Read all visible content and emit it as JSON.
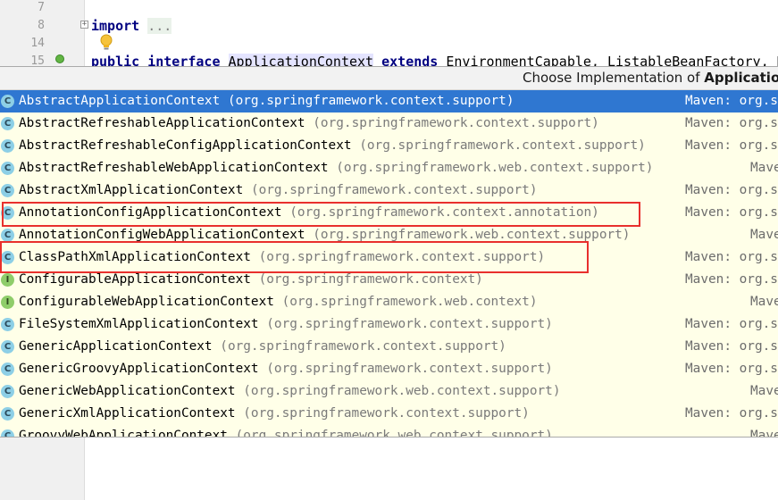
{
  "editor": {
    "gutter_lines": [
      "7",
      "8",
      "14",
      "15"
    ],
    "line8_keyword": "import",
    "line8_fold": "...",
    "line15": {
      "kw_public": "public",
      "kw_interface": "interface",
      "name": "ApplicationContext",
      "kw_extends": "extends",
      "supers": "EnvironmentCapable, ListableBeanFactory, H"
    },
    "icons": [
      "fold-marker-icon",
      "lightbulb-icon",
      "implemented-by-icon"
    ]
  },
  "popup": {
    "title_prefix": "Choose Implementation of ",
    "title_bold": "ApplicationC",
    "items": [
      {
        "icon": "class-icon",
        "icon_glyph": "C",
        "name": "AbstractApplicationContext",
        "package": "(org.springframework.context.support)",
        "maven": "Maven: org.s"
      },
      {
        "icon": "class-icon",
        "icon_glyph": "C",
        "name": "AbstractRefreshableApplicationContext",
        "package": "(org.springframework.context.support)",
        "maven": "Maven: org.s"
      },
      {
        "icon": "class-icon",
        "icon_glyph": "C",
        "name": "AbstractRefreshableConfigApplicationContext",
        "package": "(org.springframework.context.support)",
        "maven": "Maven: org.s"
      },
      {
        "icon": "class-icon",
        "icon_glyph": "C",
        "name": "AbstractRefreshableWebApplicationContext",
        "package": "(org.springframework.web.context.support)",
        "maven": "Mave"
      },
      {
        "icon": "class-icon",
        "icon_glyph": "C",
        "name": "AbstractXmlApplicationContext",
        "package": "(org.springframework.context.support)",
        "maven": "Maven: org.s"
      },
      {
        "icon": "class-icon",
        "icon_glyph": "C",
        "name": "AnnotationConfigApplicationContext",
        "package": "(org.springframework.context.annotation)",
        "maven": "Maven: org.s"
      },
      {
        "icon": "class-icon",
        "icon_glyph": "C",
        "name": "AnnotationConfigWebApplicationContext",
        "package": "(org.springframework.web.context.support)",
        "maven": "Mave"
      },
      {
        "icon": "class-icon",
        "icon_glyph": "C",
        "name": "ClassPathXmlApplicationContext",
        "package": "(org.springframework.context.support)",
        "maven": "Maven: org.s"
      },
      {
        "icon": "interface-icon",
        "icon_glyph": "I",
        "name": "ConfigurableApplicationContext",
        "package": "(org.springframework.context)",
        "maven": "Maven: org.s"
      },
      {
        "icon": "interface-icon",
        "icon_glyph": "I",
        "name": "ConfigurableWebApplicationContext",
        "package": "(org.springframework.web.context)",
        "maven": "Mave"
      },
      {
        "icon": "class-icon",
        "icon_glyph": "C",
        "name": "FileSystemXmlApplicationContext",
        "package": "(org.springframework.context.support)",
        "maven": "Maven: org.s"
      },
      {
        "icon": "class-icon",
        "icon_glyph": "C",
        "name": "GenericApplicationContext",
        "package": "(org.springframework.context.support)",
        "maven": "Maven: org.s"
      },
      {
        "icon": "class-icon",
        "icon_glyph": "C",
        "name": "GenericGroovyApplicationContext",
        "package": "(org.springframework.context.support)",
        "maven": "Maven: org.s"
      },
      {
        "icon": "class-icon",
        "icon_glyph": "C",
        "name": "GenericWebApplicationContext",
        "package": "(org.springframework.web.context.support)",
        "maven": "Mave"
      },
      {
        "icon": "class-icon",
        "icon_glyph": "C",
        "name": "GenericXmlApplicationContext",
        "package": "(org.springframework.context.support)",
        "maven": "Maven: org.s"
      },
      {
        "icon": "class-icon",
        "icon_glyph": "C",
        "name": "GroovyWebApplicationContext",
        "package": "(org.springframework.web.context.support)",
        "maven": "Mave"
      }
    ],
    "selected_index": 0,
    "annotation_color": "#e8302d",
    "selection_color": "#2f77d1"
  }
}
